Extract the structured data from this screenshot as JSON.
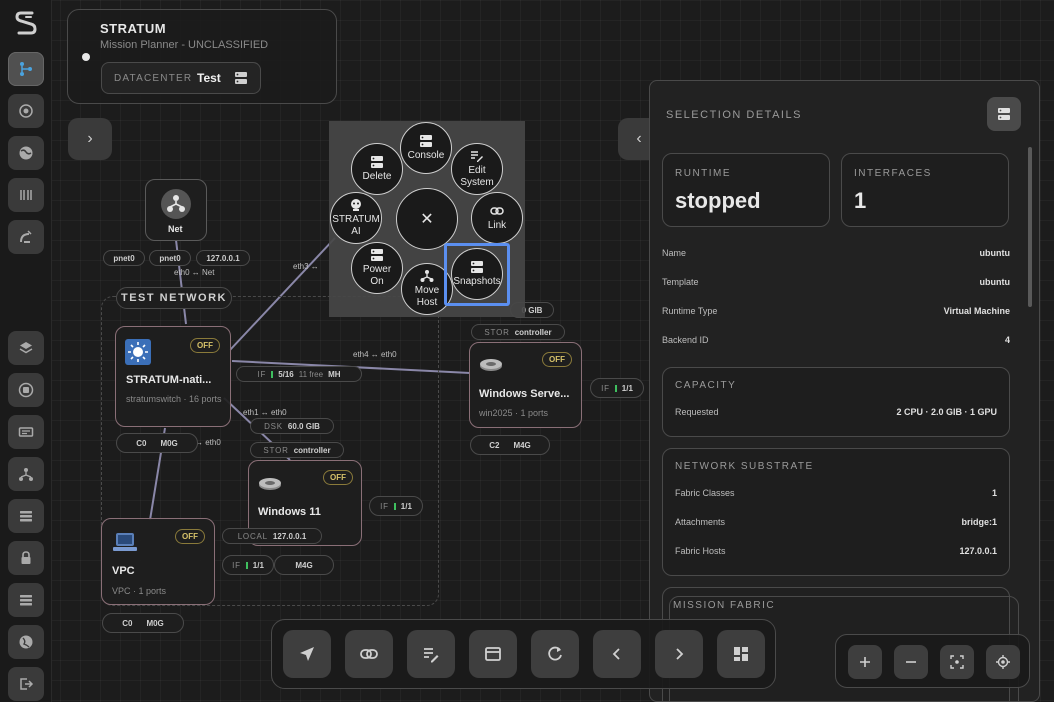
{
  "app": {
    "title": "STRATUM",
    "subtitle": "Mission Planner - UNCLASSIFIED",
    "datacenter_label": "DATACENTER",
    "datacenter_value": "Test"
  },
  "sidebar": {
    "items": [
      {
        "name": "topology-icon"
      },
      {
        "name": "target-icon"
      },
      {
        "name": "globe-icon"
      },
      {
        "name": "bars-icon"
      },
      {
        "name": "satellite-icon"
      },
      {
        "name": "layers-icon"
      },
      {
        "name": "disk-icon"
      },
      {
        "name": "server-card-icon"
      },
      {
        "name": "network-icon"
      },
      {
        "name": "list-icon"
      },
      {
        "name": "lock-icon"
      },
      {
        "name": "list-alt-icon"
      },
      {
        "name": "world-icon"
      },
      {
        "name": "logout-icon"
      }
    ]
  },
  "canvas": {
    "net_node": {
      "title": "Net"
    },
    "net_ports": [
      "pnet0",
      "pnet0",
      "127.0.0.1"
    ],
    "edge_labels": {
      "eth0_net": "eth0 ↔ Net",
      "eth3": "eth3 ↔",
      "eth4": "eth4 ↔ eth0",
      "eth1": "eth1 ↔ eth0",
      "eth0_vpc": "↔ eth0"
    },
    "network_group_label": "TEST NETWORK",
    "nodes": {
      "switch": {
        "title": "STRATUM-nati...",
        "sub": "stratumswitch · 16 ports",
        "badge": "OFF"
      },
      "windows_server": {
        "title": "Windows Serve...",
        "sub": "win2025 · 1 ports",
        "badge": "OFF"
      },
      "windows11": {
        "title": "Windows 11",
        "badge": "OFF"
      },
      "vpc": {
        "title": "VPC",
        "sub": "VPC · 1 ports",
        "badge": "OFF"
      }
    },
    "pills": {
      "switch_if": {
        "k": "IF",
        "v": "5/16",
        "extra": "11 free",
        "tail": "MH"
      },
      "switch_res": {
        "a": "C0",
        "b": "M0G"
      },
      "ws_stor": {
        "k": "STOR",
        "v": "controller"
      },
      "ws_gib": {
        "v": "0 GIB"
      },
      "ws_if": {
        "k": "IF",
        "v": "1/1"
      },
      "ws_res": {
        "a": "C2",
        "b": "M4G"
      },
      "w11_dsk": {
        "k": "DSK",
        "v": "60.0 GIB"
      },
      "w11_stor": {
        "k": "STOR",
        "v": "controller"
      },
      "w11_if": {
        "k": "IF",
        "v": "1/1"
      },
      "w11_local": {
        "k": "LOCAL",
        "v": "127.0.0.1"
      },
      "w11_if2": {
        "k": "IF",
        "v": "1/1"
      },
      "w11_res": {
        "b": "M4G"
      },
      "vpc_res": {
        "a": "C0",
        "b": "M0G"
      }
    }
  },
  "radial_menu": {
    "items": {
      "console": "Console",
      "delete": "Delete",
      "edit_system_1": "Edit",
      "edit_system_2": "System",
      "stratum_ai_1": "STRATUM",
      "stratum_ai_2": "AI",
      "link": "Link",
      "power_on_1": "Power",
      "power_on_2": "On",
      "move_host_1": "Move",
      "move_host_2": "Host",
      "snapshots": "Snapshots"
    },
    "close": "✕",
    "highlight_color": "#5b8ff0"
  },
  "details": {
    "title": "SELECTION DETAILS",
    "runtime_label": "RUNTIME",
    "runtime_value": "stopped",
    "interfaces_label": "INTERFACES",
    "interfaces_value": "1",
    "fields": [
      {
        "k": "Name",
        "v": "ubuntu"
      },
      {
        "k": "Template",
        "v": "ubuntu"
      },
      {
        "k": "Runtime Type",
        "v": "Virtual Machine"
      },
      {
        "k": "Backend ID",
        "v": "4"
      }
    ],
    "capacity": {
      "title": "CAPACITY",
      "k": "Requested",
      "v": "2 CPU · 2.0 GIB · 1 GPU"
    },
    "network_substrate": {
      "title": "NETWORK SUBSTRATE",
      "fields": [
        {
          "k": "Fabric Classes",
          "v": "1"
        },
        {
          "k": "Attachments",
          "v": "bridge:1"
        },
        {
          "k": "Fabric Hosts",
          "v": "127.0.0.1"
        }
      ]
    },
    "mission_fabric": {
      "title": "MISSION FABRIC"
    }
  },
  "toggles": {
    "left": "›",
    "right": "‹"
  },
  "toolbar": {
    "buttons": [
      "navigate-icon",
      "link-icon",
      "edit-icon",
      "window-icon",
      "refresh-icon",
      "prev-icon",
      "next-icon",
      "dashboard-icon"
    ]
  },
  "zoom": {
    "buttons": [
      "zoom-in-icon",
      "zoom-out-icon",
      "fit-icon",
      "center-icon"
    ]
  },
  "colors": {
    "accent": "#5b8ff0",
    "status_on": "#3fbf5f",
    "badge_off": "#d6c26a",
    "node_border": "#8a6f77"
  }
}
